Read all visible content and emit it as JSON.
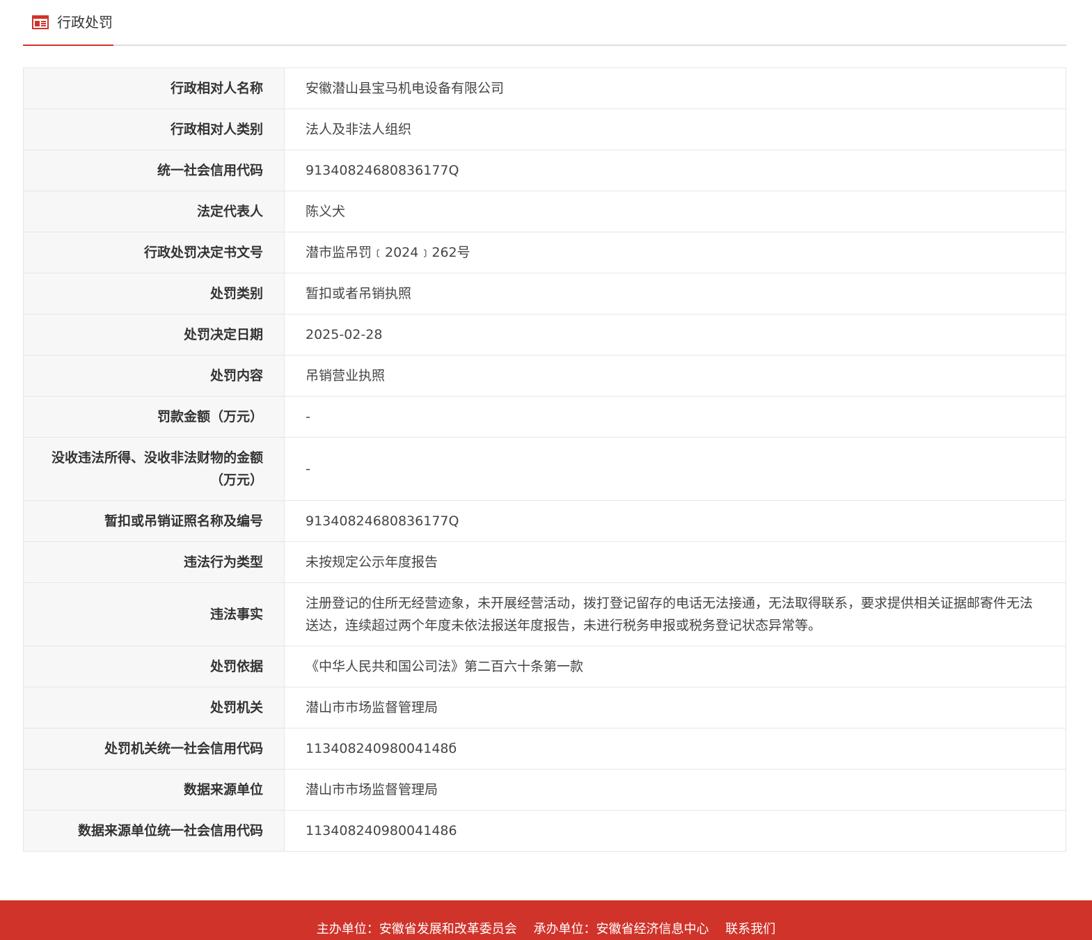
{
  "header": {
    "title": "行政处罚",
    "icon": "news-icon",
    "accent_color": "#d0332a"
  },
  "rows": [
    {
      "label": "行政相对人名称",
      "value": "安徽潜山县宝马机电设备有限公司"
    },
    {
      "label": "行政相对人类别",
      "value": "法人及非法人组织"
    },
    {
      "label": "统一社会信用代码",
      "value": "91340824680836177Q"
    },
    {
      "label": "法定代表人",
      "value": "陈义犬"
    },
    {
      "label": "行政处罚决定书文号",
      "value": "潜市监吊罚﹝2024﹞262号"
    },
    {
      "label": "处罚类别",
      "value": "暂扣或者吊销执照"
    },
    {
      "label": "处罚决定日期",
      "value": "2025-02-28"
    },
    {
      "label": "处罚内容",
      "value": "吊销营业执照"
    },
    {
      "label": "罚款金额（万元）",
      "value": "-"
    },
    {
      "label": "没收违法所得、没收非法财物的金额（万元）",
      "value": "-"
    },
    {
      "label": "暂扣或吊销证照名称及编号",
      "value": "91340824680836177Q"
    },
    {
      "label": "违法行为类型",
      "value": "未按规定公示年度报告"
    },
    {
      "label": "违法事实",
      "value": "注册登记的住所无经营迹象，未开展经营活动，拨打登记留存的电话无法接通，无法取得联系，要求提供相关证据邮寄件无法送达，连续超过两个年度未依法报送年度报告，未进行税务申报或税务登记状态异常等。"
    },
    {
      "label": "处罚依据",
      "value": "《中华人民共和国公司法》第二百六十条第一款"
    },
    {
      "label": "处罚机关",
      "value": "潜山市市场监督管理局"
    },
    {
      "label": "处罚机关统一社会信用代码",
      "value": "11340824098004148б"
    },
    {
      "label": "数据来源单位",
      "value": "潜山市市场监督管理局"
    },
    {
      "label": "数据来源单位统一社会信用代码",
      "value": "113408240980041486"
    }
  ],
  "footer": {
    "sponsor": "主办单位：安徽省发展和改革委员会",
    "organizer": "承办单位：安徽省经济信息中心",
    "contact_link": "联系我们",
    "background_color": "#d0332a"
  }
}
